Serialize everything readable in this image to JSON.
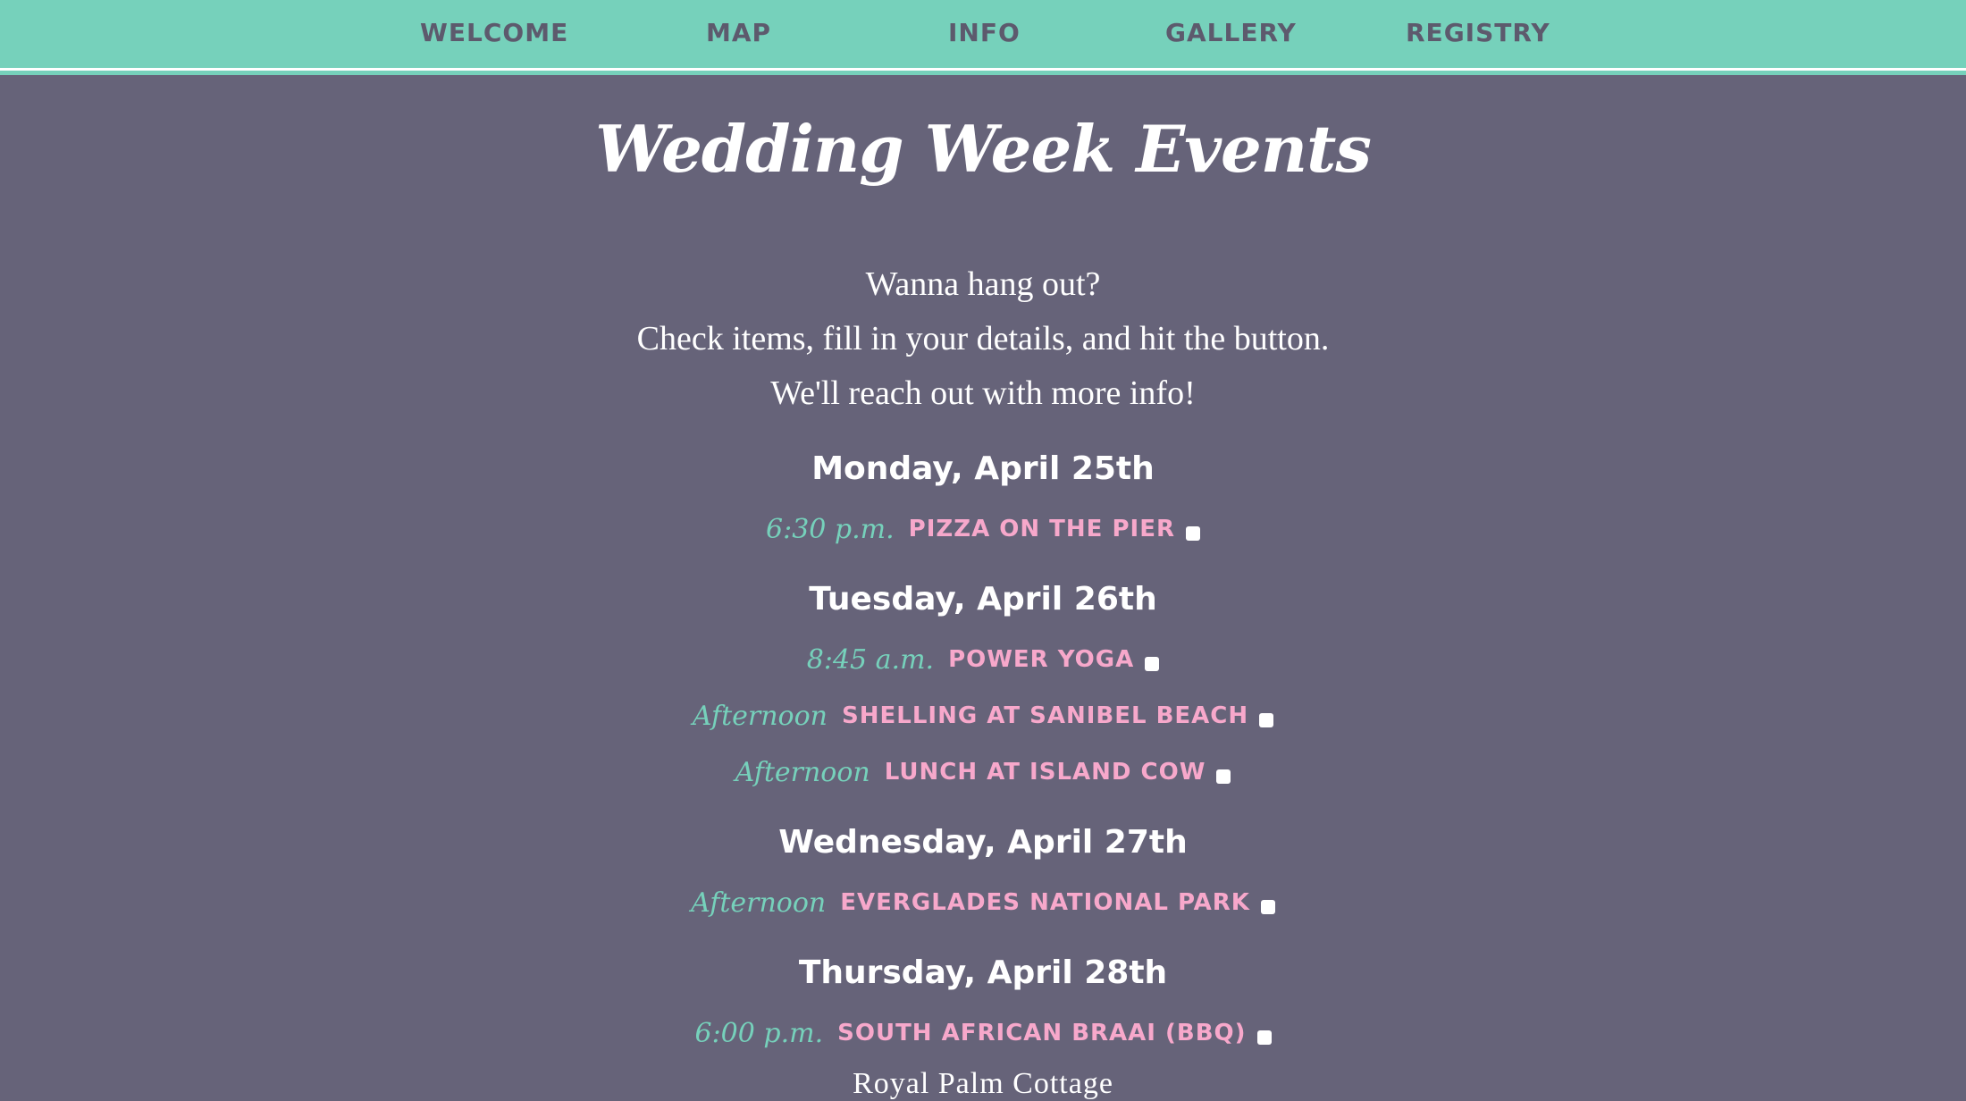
{
  "nav": {
    "items": [
      "WELCOME",
      "MAP",
      "INFO",
      "GALLERY",
      "REGISTRY"
    ]
  },
  "page": {
    "title": "Wedding Week Events",
    "intro": [
      "Wanna hang out?",
      "Check items, fill in your details, and hit the button.",
      "We'll reach out with more info!"
    ]
  },
  "days": [
    {
      "heading": "Monday, April 25th",
      "events": [
        {
          "time": "6:30 p.m.",
          "name": "PIZZA ON THE PIER",
          "checked": false
        }
      ]
    },
    {
      "heading": "Tuesday, April 26th",
      "events": [
        {
          "time": "8:45 a.m.",
          "name": "POWER YOGA",
          "checked": false
        },
        {
          "time": "Afternoon",
          "name": "SHELLING AT SANIBEL BEACH",
          "checked": false
        },
        {
          "time": "Afternoon",
          "name": "LUNCH AT ISLAND COW",
          "checked": false
        }
      ]
    },
    {
      "heading": "Wednesday, April 27th",
      "events": [
        {
          "time": "Afternoon",
          "name": "EVERGLADES NATIONAL PARK",
          "checked": false
        }
      ]
    },
    {
      "heading": "Thursday, April 28th",
      "events": [
        {
          "time": "6:00 p.m.",
          "name": "SOUTH AFRICAN BRAAI (BBQ)",
          "checked": false
        }
      ]
    }
  ],
  "venue": "Royal Palm Cottage",
  "colors": {
    "background": "#666379",
    "nav_background": "#76d1bb",
    "nav_text": "#5d5a6d",
    "time_text": "#76d1bb",
    "event_text": "#f7a8cb",
    "heading_text": "#ffffff"
  }
}
